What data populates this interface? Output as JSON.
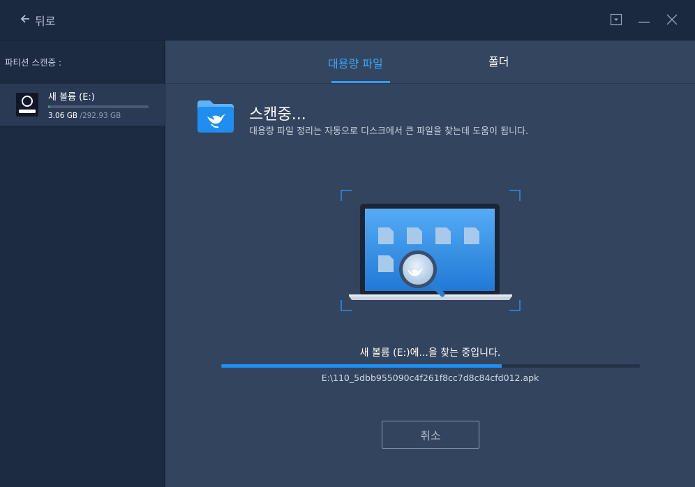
{
  "titlebar": {
    "back_label": "뒤로"
  },
  "sidebar": {
    "scan_label": "파티션 스캔중 :",
    "partitions": [
      {
        "name": "새 볼륨 (E:)",
        "used": "3.06 GB",
        "total": "/292.93 GB",
        "used_fraction": 0.0105
      }
    ]
  },
  "tabs": [
    {
      "label": "대용량 파일",
      "active": true
    },
    {
      "label": "폴더",
      "active": false
    }
  ],
  "scan": {
    "title": "스캔중...",
    "description": "대용량 파일 정리는 자동으로 디스크에서 큰 파일을 찾는데 도움이 됩니다.",
    "status_text": "새 볼륨 (E:)에...을 찾는 중입니다.",
    "progress_percent": 67,
    "current_file": "E:\\110_5dbb955090c4f261f8cc7d8c84cfd012.apk"
  },
  "actions": {
    "cancel_label": "취소"
  },
  "colors": {
    "accent": "#2f9bff",
    "progress": "#1e8ff0",
    "partition_bar": "#3db96a",
    "background_main": "#33445f",
    "background_sidebar": "#1c2a42"
  },
  "icons": [
    "back-arrow-icon",
    "dropdown-box-icon",
    "minimize-icon",
    "close-icon",
    "drive-icon",
    "folder-whale-icon",
    "laptop-scan-illustration"
  ]
}
